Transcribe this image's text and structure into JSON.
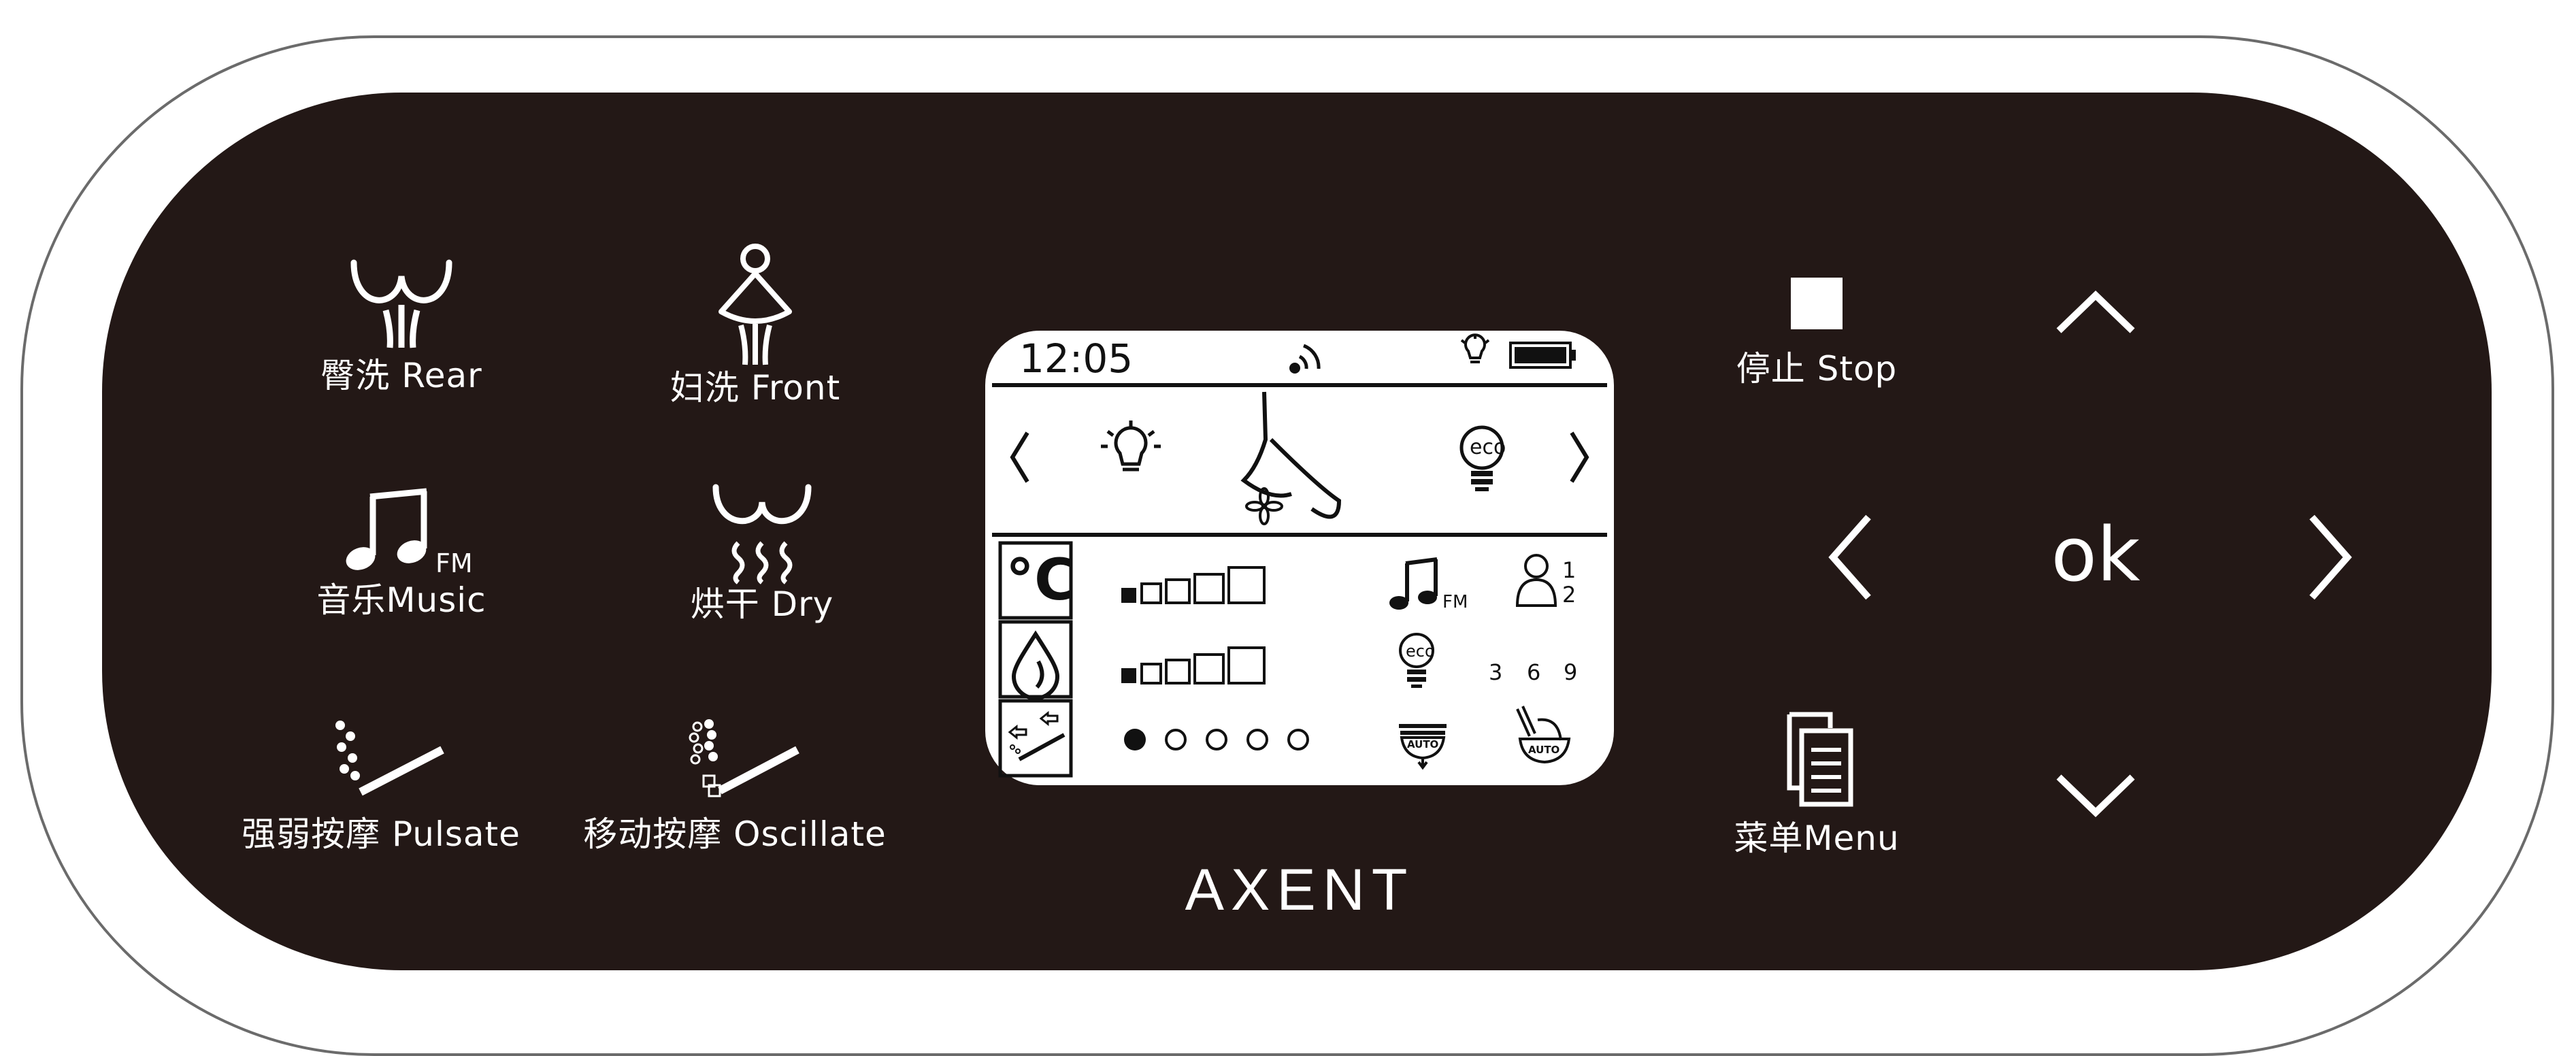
{
  "buttons": {
    "rear": "臀洗 Rear",
    "front": "妇洗 Front",
    "music": "音乐Music",
    "dry": "烘干 Dry",
    "pulsate": "强弱按摩 Pulsate",
    "oscillate": "移动按摩 Oscillate",
    "stop": "停止 Stop",
    "menu": "菜单Menu",
    "ok": "ok"
  },
  "display": {
    "time": "12:05",
    "fm": "FM",
    "eco": "eco",
    "auto": "AUTO",
    "user_1": "1",
    "user_2": "2",
    "timer_options": [
      "3",
      "6",
      "9"
    ],
    "temp_unit": "°C"
  },
  "brand": "AXENT",
  "colors": {
    "panel": "#231816",
    "display_bg": "#ffffff",
    "foreground": "#ffffff"
  },
  "indicators": {
    "temperature_level": 1,
    "temperature_max": 5,
    "water_pressure_level": 1,
    "water_pressure_max": 5,
    "position_level": 1,
    "position_max": 5
  }
}
